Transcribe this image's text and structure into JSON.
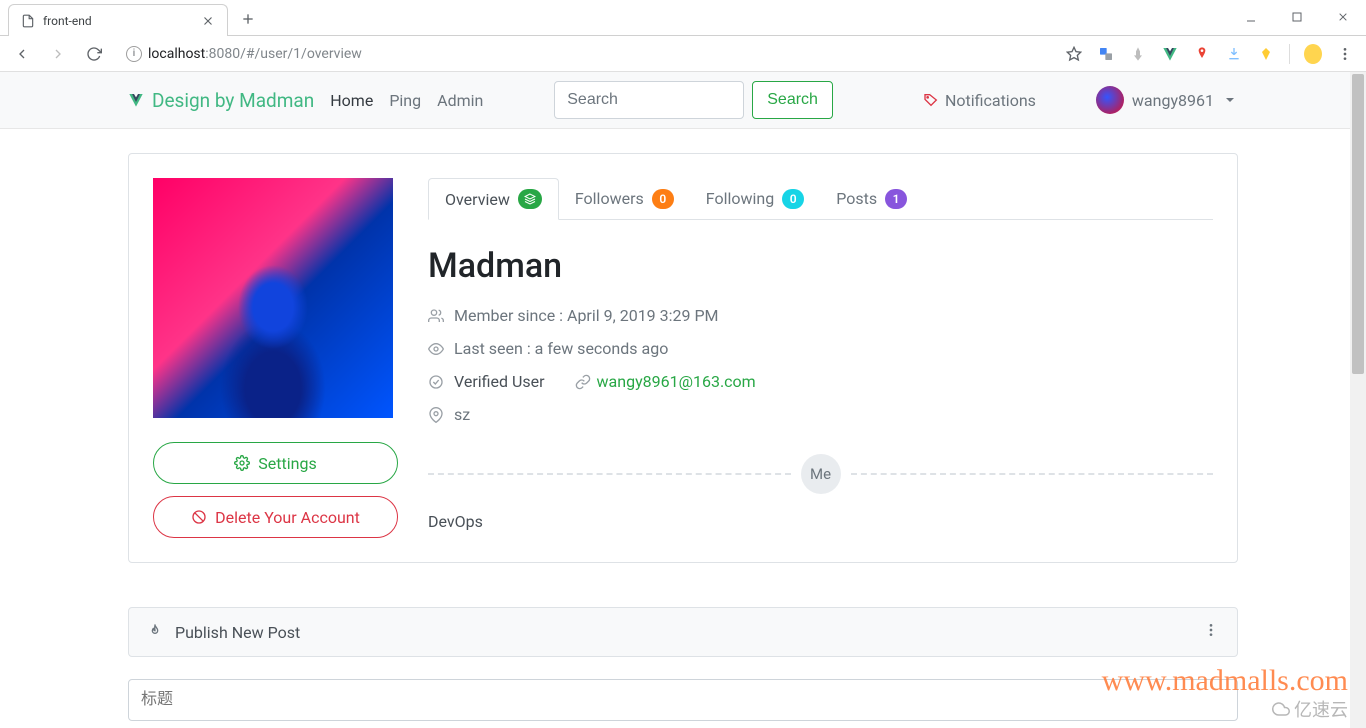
{
  "browser": {
    "tab_title": "front-end",
    "url_host": "localhost",
    "url_rest": ":8080/#/user/1/overview"
  },
  "navbar": {
    "brand": "Design by  Madman",
    "links": [
      {
        "label": "Home",
        "active": true
      },
      {
        "label": "Ping",
        "active": false
      },
      {
        "label": "Admin",
        "active": false
      }
    ],
    "search_placeholder": "Search",
    "search_button": "Search",
    "notifications": "Notifications",
    "username": "wangy8961"
  },
  "profile": {
    "tabs": {
      "overview": {
        "label": "Overview"
      },
      "followers": {
        "label": "Followers",
        "count": "0"
      },
      "following": {
        "label": "Following",
        "count": "0"
      },
      "posts": {
        "label": "Posts",
        "count": "1"
      }
    },
    "name": "Madman",
    "member_since": "Member since : April 9, 2019 3:29 PM",
    "last_seen": "Last seen : a few seconds ago",
    "verified": "Verified User",
    "email": "wangy8961@163.com",
    "location": "sz",
    "divider_label": "Me",
    "bio": "DevOps",
    "settings_label": "Settings",
    "delete_label": "Delete Your Account"
  },
  "publish": {
    "title": "Publish New Post",
    "input_placeholder": "标题"
  },
  "watermark": {
    "main": "www.madmalls.com",
    "sub": "亿速云"
  }
}
